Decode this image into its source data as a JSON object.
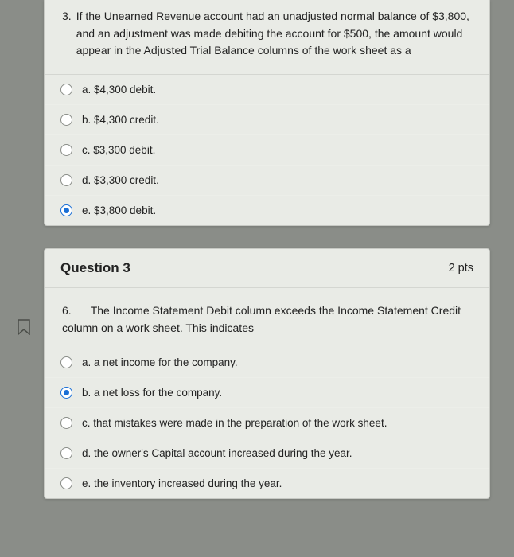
{
  "q1": {
    "number": "3.",
    "prompt": "If the Unearned Revenue account had an unadjusted normal balance of $3,800, and an adjustment was made debiting the account for $500, the amount would appear in the Adjusted Trial Balance columns of the work sheet as a",
    "options": [
      {
        "label": "a. $4,300 debit.",
        "selected": false
      },
      {
        "label": "b. $4,300 credit.",
        "selected": false
      },
      {
        "label": "c. $3,300 debit.",
        "selected": false
      },
      {
        "label": "d. $3,300 credit.",
        "selected": false
      },
      {
        "label": "e. $3,800 debit.",
        "selected": true
      }
    ]
  },
  "q2": {
    "header_title": "Question 3",
    "points": "2 pts",
    "number": "6.",
    "prompt": "The Income Statement Debit column exceeds the Income Statement Credit column on a work sheet. This indicates",
    "options": [
      {
        "label": "a. a net income for the company.",
        "selected": false
      },
      {
        "label": "b. a net loss for the company.",
        "selected": true
      },
      {
        "label": "c. that mistakes were made in the preparation of the work sheet.",
        "selected": false
      },
      {
        "label": "d. the owner's Capital account increased during the year.",
        "selected": false
      },
      {
        "label": "e. the inventory increased during the year.",
        "selected": false
      }
    ]
  }
}
